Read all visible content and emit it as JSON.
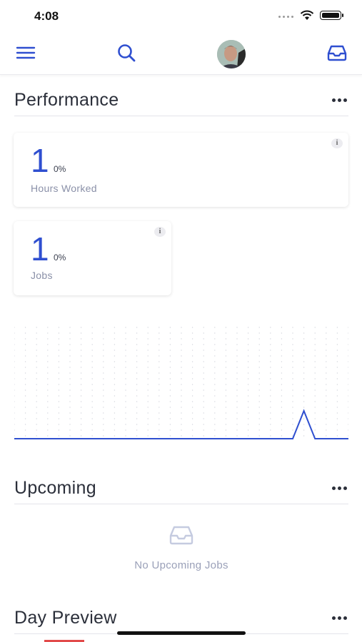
{
  "status_bar": {
    "time": "4:08"
  },
  "nav": {
    "menu_icon": "menu-icon",
    "search_icon": "search-icon",
    "avatar": "user-avatar",
    "inbox_icon": "inbox-icon"
  },
  "performance": {
    "title": "Performance",
    "cards": [
      {
        "value": "1",
        "change": "0%",
        "label": "Hours Worked"
      },
      {
        "value": "1",
        "change": "0%",
        "label": "Jobs"
      }
    ],
    "info_label": "i"
  },
  "chart_data": {
    "type": "line",
    "title": "",
    "xlabel": "",
    "ylabel": "",
    "x": [
      1,
      2,
      3,
      4,
      5,
      6,
      7,
      8,
      9,
      10,
      11,
      12,
      13,
      14,
      15,
      16,
      17,
      18,
      19,
      20,
      21,
      22,
      23,
      24,
      25,
      26,
      27,
      28,
      29,
      30,
      31
    ],
    "series": [
      {
        "values": [
          0,
          0,
          0,
          0,
          0,
          0,
          0,
          0,
          0,
          0,
          0,
          0,
          0,
          0,
          0,
          0,
          0,
          0,
          0,
          0,
          0,
          0,
          0,
          0,
          0,
          0,
          1,
          0,
          0,
          0,
          0
        ]
      }
    ],
    "ylim": [
      0,
      4
    ],
    "grid": "dotted",
    "color": "#2f4fd0"
  },
  "upcoming": {
    "title": "Upcoming",
    "empty_text": "No Upcoming Jobs"
  },
  "day_preview": {
    "title": "Day Preview"
  }
}
